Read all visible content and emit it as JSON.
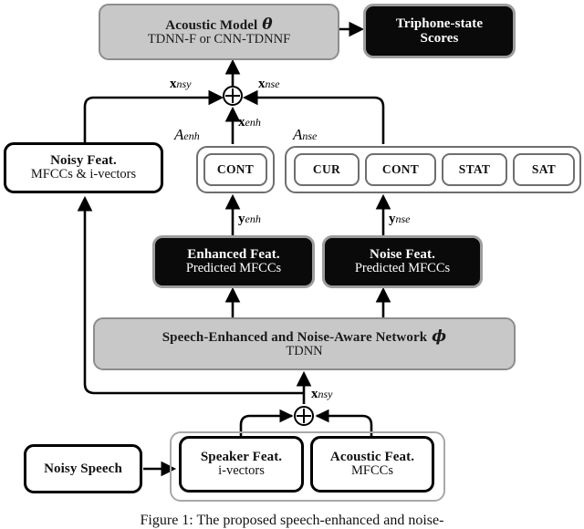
{
  "figure": {
    "caption": "Figure 1:  The proposed speech-enhanced and noise-"
  },
  "nodes": {
    "acoustic_model": {
      "title": "Acoustic Model",
      "param": "θ",
      "subtitle": "TDNN-F or CNN-TDNNF",
      "style": "gray"
    },
    "triphone_scores": {
      "line1": "Triphone-state",
      "line2": "Scores",
      "style": "black"
    },
    "noisy_feat": {
      "title": "Noisy Feat.",
      "subtitle": "MFCCs & i-vectors",
      "style": "white"
    },
    "enhanced_feat": {
      "title": "Enhanced Feat.",
      "subtitle": "Predicted MFCCs",
      "style": "black"
    },
    "noise_feat": {
      "title": "Noise Feat.",
      "subtitle": "Predicted  MFCCs",
      "style": "black"
    },
    "senn_network": {
      "title": "Speech-Enhanced and Noise-Aware Network",
      "param": "ϕ",
      "subtitle": "TDNN",
      "style": "gray"
    },
    "noisy_speech": {
      "title": "Noisy Speech",
      "style": "white"
    },
    "speaker_feat": {
      "title": "Speaker Feat.",
      "subtitle": "i-vectors",
      "style": "white"
    },
    "acoustic_feat": {
      "title": "Acoustic Feat.",
      "subtitle": "MFCCs",
      "style": "white"
    }
  },
  "groups": {
    "a_enh": {
      "label": "A",
      "sublabel": "enh",
      "chips": [
        "CONT"
      ]
    },
    "a_nse": {
      "label": "A",
      "sublabel": "nse",
      "chips": [
        "CUR",
        "CONT",
        "STAT",
        "SAT"
      ]
    },
    "front_end": {
      "label": ""
    }
  },
  "signals": {
    "x_nsy_top": {
      "var": "x",
      "sub": "nsy"
    },
    "x_nse": {
      "var": "x",
      "sub": "nse"
    },
    "x_enh": {
      "var": "x",
      "sub": "enh"
    },
    "y_enh": {
      "var": "y",
      "sub": "enh"
    },
    "y_nse": {
      "var": "y",
      "sub": "nse"
    },
    "x_nsy_bottom": {
      "var": "x",
      "sub": "nsy"
    }
  },
  "operators": {
    "sum_top": "⊕",
    "sum_bottom": "⊕"
  },
  "colors": {
    "black_node": "#0a0a0a",
    "gray_node": "#c8c8c8",
    "white_node": "#ffffff",
    "outline": "#000000",
    "group_outline": "#a8a8a8"
  }
}
